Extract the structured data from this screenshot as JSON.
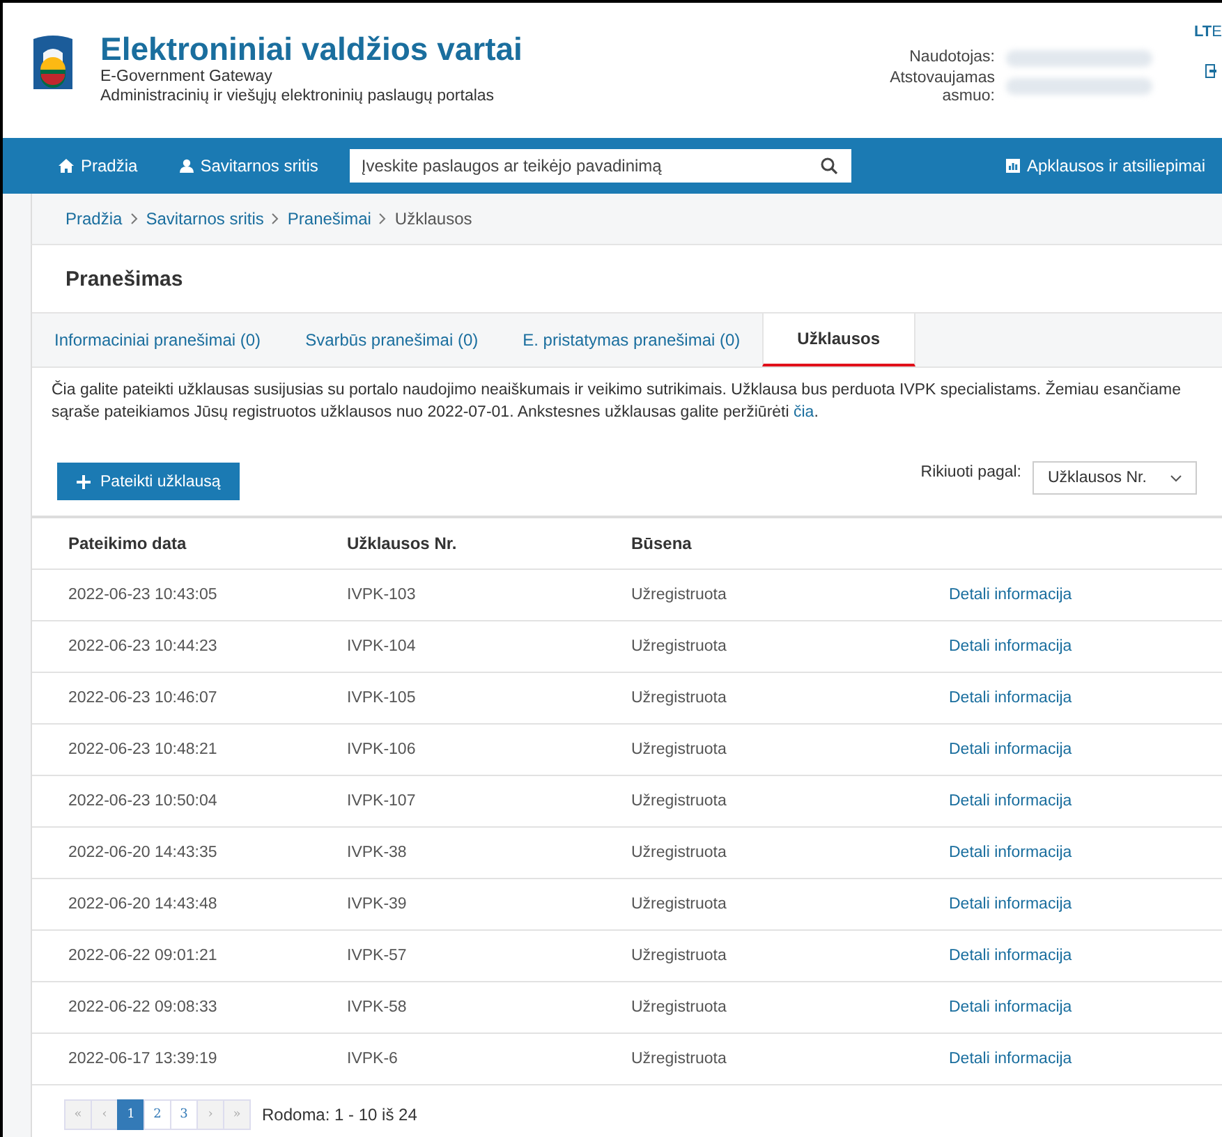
{
  "header": {
    "title": "Elektroniniai valdžios vartai",
    "subtitle": "E-Government Gateway",
    "tagline": "Administracinių ir viešųjų elektroninių paslaugų portalas",
    "user_label": "Naudotojas:",
    "represented_label": "Atstovaujamas asmuo:",
    "language": "LT",
    "language_next": "E"
  },
  "nav": {
    "items": [
      {
        "label": "Pradžia"
      },
      {
        "label": "Savitarnos sritis"
      }
    ],
    "search": {
      "placeholder": "Įveskite paslaugos ar teikėjo pavadinimą"
    },
    "survey_link": "Apklausos ir atsiliepimai"
  },
  "breadcrumb": [
    "Pradžia",
    "Savitarnos sritis",
    "Pranešimai",
    "Užklausos"
  ],
  "page_title": "Pranešimas",
  "tabs": [
    {
      "label": "Informaciniai pranešimai (0)",
      "selected": false
    },
    {
      "label": "Svarbūs pranešimai (0)",
      "selected": false
    },
    {
      "label": "E. pristatymas pranešimai (0)",
      "selected": false
    },
    {
      "label": "Užklausos",
      "selected": true
    }
  ],
  "description": "Čia galite pateikti užklausas susijusias su portalo naudojimo neaiškumais ir veikimo sutrikimais. Užklausa bus perduota IVPK specialistams. Žemiau esančiame sąraše pateikiamos Jūsų registruotos užklausos nuo 2022-07-01. Ankstesnes užklausas galite peržiūrėti",
  "description_link": "čia",
  "description_end": ".",
  "submit_button": "Pateikti užklausą",
  "sort": {
    "label": "Rikiuoti pagal:",
    "value": "Užklausos Nr."
  },
  "table": {
    "columns": [
      "Pateikimo data",
      "Užklausos Nr.",
      "Būsena"
    ],
    "rows": [
      {
        "date": "2022-06-23 10:43:05",
        "number": "IVPK-103",
        "status": "Užregistruota",
        "link": "Detali informacija"
      },
      {
        "date": "2022-06-23 10:44:23",
        "number": "IVPK-104",
        "status": "Užregistruota",
        "link": "Detali informacija"
      },
      {
        "date": "2022-06-23 10:46:07",
        "number": "IVPK-105",
        "status": "Užregistruota",
        "link": "Detali informacija"
      },
      {
        "date": "2022-06-23 10:48:21",
        "number": "IVPK-106",
        "status": "Užregistruota",
        "link": "Detali informacija"
      },
      {
        "date": "2022-06-23 10:50:04",
        "number": "IVPK-107",
        "status": "Užregistruota",
        "link": "Detali informacija"
      },
      {
        "date": "2022-06-20 14:43:35",
        "number": "IVPK-38",
        "status": "Užregistruota",
        "link": "Detali informacija"
      },
      {
        "date": "2022-06-20 14:43:48",
        "number": "IVPK-39",
        "status": "Užregistruota",
        "link": "Detali informacija"
      },
      {
        "date": "2022-06-22 09:01:21",
        "number": "IVPK-57",
        "status": "Užregistruota",
        "link": "Detali informacija"
      },
      {
        "date": "2022-06-22 09:08:33",
        "number": "IVPK-58",
        "status": "Užregistruota",
        "link": "Detali informacija"
      },
      {
        "date": "2022-06-17 13:39:19",
        "number": "IVPK-6",
        "status": "Užregistruota",
        "link": "Detali informacija"
      }
    ]
  },
  "pagination": {
    "pages": [
      {
        "label": "«",
        "kind": "first",
        "selected": false
      },
      {
        "label": "‹",
        "kind": "prev",
        "selected": false
      },
      {
        "label": "1",
        "kind": "page",
        "selected": true
      },
      {
        "label": "2",
        "kind": "page",
        "selected": false
      },
      {
        "label": "3",
        "kind": "page",
        "selected": false
      },
      {
        "label": "›",
        "kind": "next",
        "selected": false
      },
      {
        "label": "»",
        "kind": "last",
        "selected": false
      }
    ],
    "summary": "Rodoma: 1 - 10 iš 24"
  }
}
